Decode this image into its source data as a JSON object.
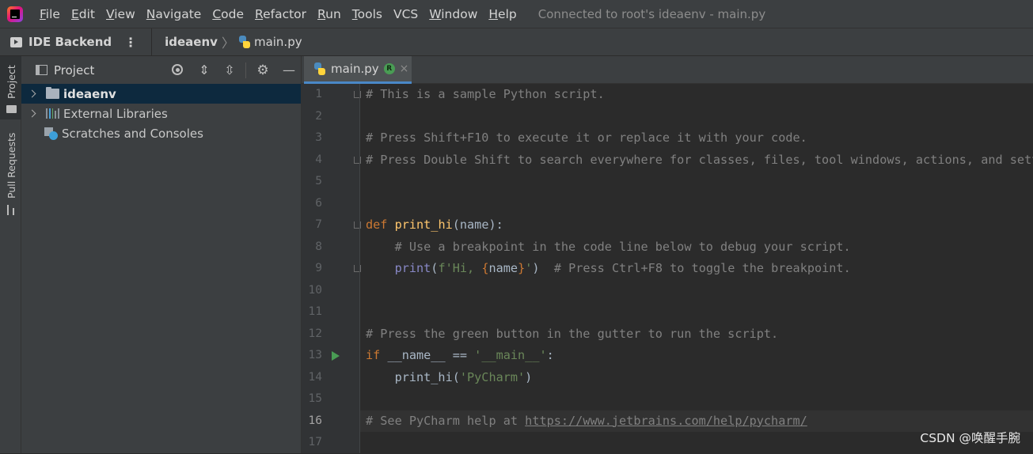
{
  "menubar": {
    "items": [
      {
        "mnemonic": "F",
        "rest": "ile"
      },
      {
        "mnemonic": "E",
        "rest": "dit"
      },
      {
        "mnemonic": "V",
        "rest": "iew"
      },
      {
        "mnemonic": "N",
        "rest": "avigate"
      },
      {
        "mnemonic": "C",
        "rest": "ode"
      },
      {
        "mnemonic": "R",
        "rest": "efactor"
      },
      {
        "mnemonic": "R",
        "rest": "un"
      },
      {
        "mnemonic": "T",
        "rest": "ools"
      },
      {
        "mnemonic": "",
        "rest": "VCS"
      },
      {
        "mnemonic": "W",
        "rest": "indow"
      },
      {
        "mnemonic": "H",
        "rest": "elp"
      }
    ],
    "window_title": "Connected to root's ideaenv - main.py"
  },
  "navbar": {
    "backend_label": "IDE Backend",
    "backend_menu": "⋮",
    "project": "ideaenv",
    "separator": "〉",
    "file": "main.py"
  },
  "left_strip": {
    "project_label": "Project",
    "pull_requests_label": "Pull Requests"
  },
  "project_panel": {
    "title": "Project",
    "tree": [
      {
        "label": "ideaenv",
        "icon": "folder-icon",
        "expandable": true,
        "selected": true
      },
      {
        "label": "External Libraries",
        "icon": "library-icon",
        "expandable": true,
        "selected": false
      },
      {
        "label": "Scratches and Consoles",
        "icon": "scratch-icon",
        "expandable": false,
        "selected": false
      }
    ]
  },
  "editor": {
    "tab": {
      "label": "main.py",
      "badge": "R",
      "close": "×"
    },
    "current_line": 16,
    "lines": [
      {
        "n": "1"
      },
      {
        "n": "2"
      },
      {
        "n": "3"
      },
      {
        "n": "4"
      },
      {
        "n": "5"
      },
      {
        "n": "6"
      },
      {
        "n": "7"
      },
      {
        "n": "8"
      },
      {
        "n": "9"
      },
      {
        "n": "10"
      },
      {
        "n": "11"
      },
      {
        "n": "12"
      },
      {
        "n": "13"
      },
      {
        "n": "14"
      },
      {
        "n": "15"
      },
      {
        "n": "16"
      },
      {
        "n": "17"
      }
    ],
    "code": {
      "l1": "# This is a sample Python script.",
      "l3": "# Press Shift+F10 to execute it or replace it with your code.",
      "l4": "# Press Double Shift to search everywhere for classes, files, tool windows, actions, and settings.",
      "l7_kw": "def",
      "l7_fn": "print_hi",
      "l7_rest": "(name):",
      "l8": "    # Use a breakpoint in the code line below to debug your script.",
      "l9_indent": "    ",
      "l9_bi": "print",
      "l9_p1": "(",
      "l9_str1": "f'Hi, ",
      "l9_br1": "{",
      "l9_name": "name",
      "l9_br2": "}",
      "l9_str2": "'",
      "l9_p2": ")",
      "l9_cmt": "  # Press Ctrl+F8 to toggle the breakpoint.",
      "l12": "# Press the green button in the gutter to run the script.",
      "l13_kw": "if",
      "l13_mid": " __name__ == ",
      "l13_str": "'__main__'",
      "l13_end": ":",
      "l14_fn": "    print_hi(",
      "l14_str": "'PyCharm'",
      "l14_end": ")",
      "l16_cmt": "# See PyCharm help at ",
      "l16_url": "https://www.jetbrains.com/help/pycharm/"
    }
  },
  "watermark": "CSDN @唤醒手腕",
  "colors": {
    "background": "#2b2b2b",
    "keyword": "#cc7832",
    "function": "#ffc66d",
    "string": "#6a8759",
    "comment": "#808080",
    "builtin": "#8888c6",
    "selection": "#0d293e",
    "run_icon": "#499c54"
  }
}
